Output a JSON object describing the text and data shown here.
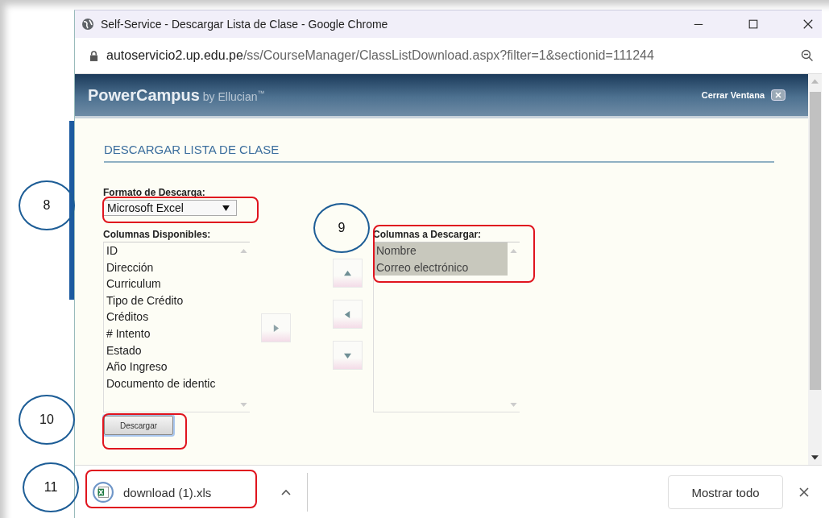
{
  "window": {
    "title": "Self-Service - Descargar Lista de Clase - Google Chrome"
  },
  "address_bar": {
    "domain": "autoservicio2.up.edu.pe",
    "path": "/ss/CourseManager/ClassListDownload.aspx?filter=1&sectionid=111244"
  },
  "header": {
    "brand": "PowerCampus",
    "brand_suffix": "by Ellucian",
    "trademark": "™",
    "close_label": "Cerrar Ventana"
  },
  "heading": "DESCARGAR LISTA DE CLASE",
  "format": {
    "label": "Formato de Descarga:",
    "value": "Microsoft Excel"
  },
  "available_columns": {
    "label": "Columnas Disponibles:",
    "items": [
      {
        "label": "ID",
        "selected": false
      },
      {
        "label": "Dirección",
        "selected": false
      },
      {
        "label": "Curriculum",
        "selected": false
      },
      {
        "label": "Tipo de Crédito",
        "selected": false
      },
      {
        "label": "Créditos",
        "selected": false
      },
      {
        "label": "# Intento",
        "selected": false
      },
      {
        "label": "Estado",
        "selected": false
      },
      {
        "label": "Año Ingreso",
        "selected": false
      },
      {
        "label": "Documento de identic",
        "selected": false
      }
    ]
  },
  "download_columns": {
    "label": "Columnas a Descargar:",
    "items": [
      {
        "label": "Nombre",
        "selected": true
      },
      {
        "label": "Correo electrónico",
        "selected": true
      }
    ]
  },
  "download_button": "Descargar",
  "download_bar": {
    "file": "download (1).xls",
    "show_all": "Mostrar todo"
  },
  "annotations": [
    {
      "number": "8"
    },
    {
      "number": "9"
    },
    {
      "number": "10"
    },
    {
      "number": "11"
    }
  ]
}
